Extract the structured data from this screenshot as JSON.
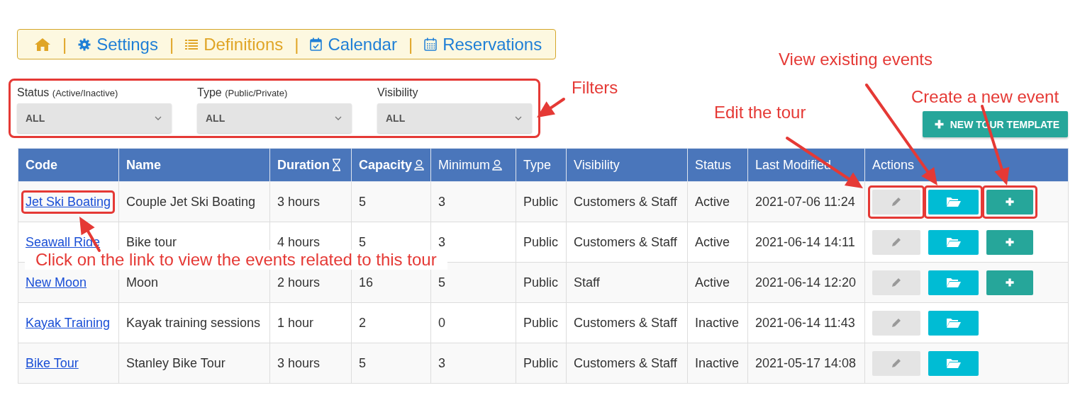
{
  "nav": [
    {
      "kind": "home"
    },
    {
      "kind": "settings",
      "separator": "|",
      "label": "Settings",
      "selected": false
    },
    {
      "kind": "definitions",
      "separator": "|",
      "label": "Definitions",
      "selected": true
    },
    {
      "kind": "calendar",
      "separator": "|",
      "label": "Calendar",
      "selected": false
    },
    {
      "kind": "reservations",
      "separator": "|",
      "label": "Reservations",
      "selected": false
    }
  ],
  "filters": {
    "highlighted": true,
    "items": [
      {
        "label": "Status",
        "hint": "(Active/Inactive)",
        "value": "ALL"
      },
      {
        "label": "Type",
        "hint": "(Public/Private)",
        "value": "ALL"
      },
      {
        "label": "Visibility",
        "value": "ALL"
      }
    ]
  },
  "new_button": {
    "label": "NEW TOUR TEMPLATE"
  },
  "table": {
    "columns": [
      {
        "label": "Code",
        "bold": true
      },
      {
        "label": "Name",
        "bold": true
      },
      {
        "label": "Duration",
        "bold": true
      },
      {
        "label": "Capacity",
        "bold": true
      },
      {
        "label": "Minimum",
        "bold": false
      },
      {
        "label": "Type",
        "bold": false
      },
      {
        "label": "Visibility",
        "bold": false
      },
      {
        "label": "Status",
        "bold": false
      },
      {
        "label": "Last Modified",
        "bold": false
      },
      {
        "label": "Actions",
        "bold": false
      }
    ],
    "rows": [
      {
        "code": "Jet Ski Boating",
        "name": "Couple Jet Ski Boating",
        "duration": "3 hours",
        "capacity": "5",
        "minimum": "3",
        "type": "Public",
        "visibility": "Customers & Staff",
        "status": "Active",
        "last_modified": "2021-07-06 11:24",
        "can_add": true,
        "highlighted": true
      },
      {
        "code": "Seawall Ride",
        "name": "Bike tour",
        "duration": "4 hours",
        "capacity": "5",
        "minimum": "3",
        "type": "Public",
        "visibility": "Customers & Staff",
        "status": "Active",
        "last_modified": "2021-06-14 14:11",
        "can_add": true,
        "highlighted": false
      },
      {
        "code": "New Moon",
        "name": "Moon",
        "duration": "2 hours",
        "capacity": "16",
        "minimum": "5",
        "type": "Public",
        "visibility": "Staff",
        "status": "Active",
        "last_modified": "2021-06-14 12:20",
        "can_add": true,
        "highlighted": false
      },
      {
        "code": "Kayak Training",
        "name": "Kayak training sessions",
        "duration": "1 hour",
        "capacity": "2",
        "minimum": "0",
        "type": "Public",
        "visibility": "Customers & Staff",
        "status": "Inactive",
        "last_modified": "2021-06-14 11:43",
        "can_add": false,
        "highlighted": false
      },
      {
        "code": "Bike Tour",
        "name": "Stanley Bike Tour",
        "duration": "3 hours",
        "capacity": "5",
        "minimum": "3",
        "type": "Public",
        "visibility": "Customers & Staff",
        "status": "Inactive",
        "last_modified": "2021-05-17 14:08",
        "can_add": false,
        "highlighted": false
      }
    ]
  },
  "annotations": [
    {
      "kind": "label",
      "text": "Filters"
    },
    {
      "kind": "label",
      "text": "View existing events"
    },
    {
      "kind": "label",
      "text": "Create a new event"
    },
    {
      "kind": "label",
      "text": "Edit the tour"
    },
    {
      "kind": "callout",
      "text": "Click on the link to view the events related to this tour"
    }
  ]
}
